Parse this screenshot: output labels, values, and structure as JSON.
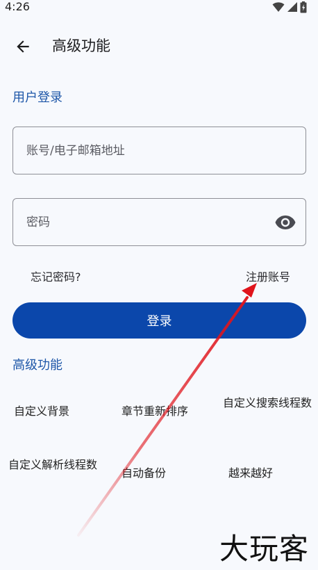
{
  "status_bar": {
    "time": "4:26",
    "icons": [
      "wifi-icon",
      "signal-icon",
      "battery-icon"
    ]
  },
  "app_bar": {
    "back_icon": "arrow-left-icon",
    "title": "高级功能"
  },
  "login": {
    "section_title": "用户登录",
    "account_placeholder": "账号/电子邮箱地址",
    "account_value": "",
    "password_placeholder": "密码",
    "password_value": "",
    "visibility_icon": "eye-icon",
    "forgot_password": "忘记密码?",
    "register": "注册账号",
    "login_button": "登录"
  },
  "features": {
    "section_title": "高级功能",
    "items": [
      "自定义背景",
      "章节重新排序",
      "自定义搜索线程数",
      "自定义解析线程数",
      "自动备份",
      "越来越好"
    ]
  },
  "watermark": "大玩客",
  "colors": {
    "accent": "#1d56a8",
    "button": "#0b47ab",
    "background": "#f7f9fd",
    "annotation_arrow": "#e0141b"
  }
}
